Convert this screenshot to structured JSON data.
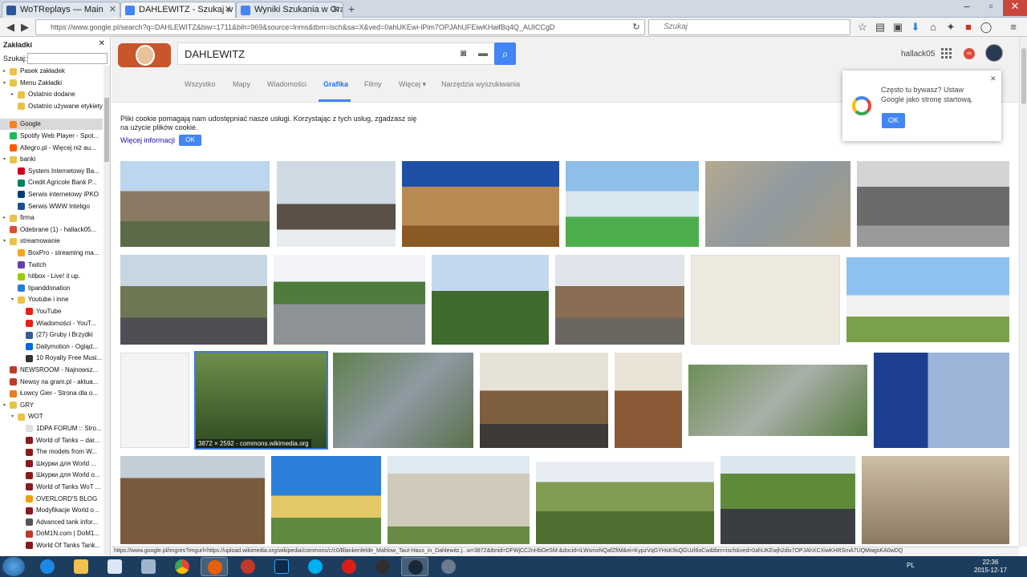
{
  "browser": {
    "tabs": [
      {
        "label": "WoTReplays — Main",
        "color": "#2b5797"
      },
      {
        "label": "DAHLEWITZ - Szukaj w Go...",
        "color": "#4285f4"
      },
      {
        "label": "Wyniki Szukania w Grafice ...",
        "color": "#4285f4"
      }
    ],
    "url": "https://www.google.pl/search?q=DAHLEWITZ&biw=1711&bih=969&source=lnms&tbm=isch&sa=X&ved=0ahUKEwi-lPim7OPJAhUFEiwKHaifBq4Q_AUICCgD",
    "search_placeholder": "Szukaj"
  },
  "sidebar": {
    "title": "Zakładki",
    "search_label": "Szukaj:",
    "items": [
      {
        "label": "Pasek zakładek",
        "indent": 0,
        "type": "folder",
        "tw": "▸"
      },
      {
        "label": "Menu Zakładki",
        "indent": 0,
        "type": "folder",
        "tw": "▾"
      },
      {
        "label": "Ostatnio dodane",
        "indent": 1,
        "type": "folder",
        "tw": "▸"
      },
      {
        "label": "Ostatnio używane etykiety",
        "indent": 1,
        "type": "folder",
        "tw": ""
      },
      {
        "label": "",
        "indent": 0,
        "type": "sep",
        "tw": ""
      },
      {
        "label": "Google",
        "indent": 0,
        "type": "site",
        "color": "#f58220",
        "tw": ""
      },
      {
        "label": "Spotify Web Player - Spot...",
        "indent": 0,
        "type": "site",
        "color": "#1db954",
        "tw": ""
      },
      {
        "label": "Allegro.pl - Więcej niż au...",
        "indent": 0,
        "type": "site",
        "color": "#ff5a00",
        "tw": ""
      },
      {
        "label": "banki",
        "indent": 0,
        "type": "folder",
        "tw": "▾"
      },
      {
        "label": "System Internetowy Ba...",
        "indent": 1,
        "type": "site",
        "color": "#d0021b",
        "tw": ""
      },
      {
        "label": "Credit Agricole Bank P...",
        "indent": 1,
        "type": "site",
        "color": "#00805f",
        "tw": ""
      },
      {
        "label": "Serwis internetowy iPKO",
        "indent": 1,
        "type": "site",
        "color": "#003c7d",
        "tw": ""
      },
      {
        "label": "Serwis WWW Inteligo",
        "indent": 1,
        "type": "site",
        "color": "#1a4f8b",
        "tw": ""
      },
      {
        "label": "firma",
        "indent": 0,
        "type": "folder",
        "tw": "▸"
      },
      {
        "label": "Odebrane (1) - hallack05...",
        "indent": 0,
        "type": "site",
        "color": "#dd4b39",
        "tw": ""
      },
      {
        "label": "streamowanie",
        "indent": 0,
        "type": "folder",
        "tw": "▾"
      },
      {
        "label": "BoxPro - streaming ma...",
        "indent": 1,
        "type": "site",
        "color": "#f5a623",
        "tw": ""
      },
      {
        "label": "Twitch",
        "indent": 1,
        "type": "site",
        "color": "#6441a5",
        "tw": ""
      },
      {
        "label": "hitbox - Live! it up.",
        "indent": 1,
        "type": "site",
        "color": "#99cc00",
        "tw": ""
      },
      {
        "label": "tipanddonation",
        "indent": 1,
        "type": "site",
        "color": "#2b7bd8",
        "tw": ""
      },
      {
        "label": "Youtube i inne",
        "indent": 1,
        "type": "folder",
        "tw": "▾"
      },
      {
        "label": "YouTube",
        "indent": 2,
        "type": "site",
        "color": "#e62117",
        "tw": ""
      },
      {
        "label": "Wiadomości - YouT...",
        "indent": 2,
        "type": "site",
        "color": "#e62117",
        "tw": ""
      },
      {
        "label": "(27) Gruby i Brzydki",
        "indent": 2,
        "type": "site",
        "color": "#3b5998",
        "tw": ""
      },
      {
        "label": "Dailymotion - Ogląd...",
        "indent": 2,
        "type": "site",
        "color": "#0066dc",
        "tw": ""
      },
      {
        "label": "10 Royalty Free Musi...",
        "indent": 2,
        "type": "site",
        "color": "#333333",
        "tw": ""
      },
      {
        "label": "NEWSROOM - Najnowsz...",
        "indent": 0,
        "type": "site",
        "color": "#c0392b",
        "tw": ""
      },
      {
        "label": "Newsy na gram.pl - aktua...",
        "indent": 0,
        "type": "site",
        "color": "#c0392b",
        "tw": ""
      },
      {
        "label": "Łowcy Gier - Strona dla o...",
        "indent": 0,
        "type": "site",
        "color": "#e67e22",
        "tw": ""
      },
      {
        "label": "GRY",
        "indent": 0,
        "type": "folder",
        "tw": "▾"
      },
      {
        "label": "WOT",
        "indent": 1,
        "type": "folder",
        "tw": "▾"
      },
      {
        "label": "1DPA FORUM :: Stro...",
        "indent": 2,
        "type": "site",
        "color": "#dddddd",
        "tw": ""
      },
      {
        "label": "World of Tanks – dar...",
        "indent": 2,
        "type": "site",
        "color": "#8b1a1a",
        "tw": ""
      },
      {
        "label": "The models from W...",
        "indent": 2,
        "type": "site",
        "color": "#8b1a1a",
        "tw": ""
      },
      {
        "label": "Шкурки для World ...",
        "indent": 2,
        "type": "site",
        "color": "#8b1a1a",
        "tw": ""
      },
      {
        "label": "Шкурки для World o...",
        "indent": 2,
        "type": "site",
        "color": "#8b1a1a",
        "tw": ""
      },
      {
        "label": "World of Tanks WoT ...",
        "indent": 2,
        "type": "site",
        "color": "#8b1a1a",
        "tw": ""
      },
      {
        "label": "OVERLORD'S BLOG",
        "indent": 2,
        "type": "site",
        "color": "#f39c12",
        "tw": ""
      },
      {
        "label": "Modyfikacje World o...",
        "indent": 2,
        "type": "site",
        "color": "#8b1a1a",
        "tw": ""
      },
      {
        "label": "Advanced tank infor...",
        "indent": 2,
        "type": "site",
        "color": "#555555",
        "tw": ""
      },
      {
        "label": "DoM1N.com | DoM1...",
        "indent": 2,
        "type": "site",
        "color": "#c0392b",
        "tw": ""
      },
      {
        "label": "World Of Tanks Tank...",
        "indent": 2,
        "type": "site",
        "color": "#8b1a1a",
        "tw": ""
      }
    ]
  },
  "google": {
    "query": "DAHLEWITZ",
    "user": "hallack05",
    "tabs": [
      "Wszystko",
      "Mapy",
      "Wiadomości",
      "Grafika",
      "Filmy",
      "Więcej ▾",
      "Narzędzia wyszukiwania"
    ],
    "active_tab": "Grafika",
    "cookie_text": "Pliki cookie pomagają nam udostępniać nasze usługi. Korzystając z tych usług, zgadzasz się na użycie plików cookie.",
    "cookie_more": "Więcej informacji",
    "cookie_ok": "OK",
    "promo_text": "Często tu bywasz? Ustaw Google jako stronę startową.",
    "promo_ok": "OK",
    "image_caption": "3872 × 2592 - commons.wikimedia.org"
  },
  "status_url": "https://www.google.pl/imgres?imgurl=https://upload.wikimedia.org/wikipedia/commons/c/c0/Blankenfelde_Mahlow_Taut-Haus_in_Dahlewitz.j...w=3872&tbnid=DFWjCC2nHbOeSM:&docid=iLWsmxNQafZfiM&ei=KypzVqGYHsK9sQGUzl6oCw&tbm=isch&ved=0ahUKEwjh2dix7OPJAhXCXiwKHRSmA7UQMwgsKA0wDQ",
  "taskbar": {
    "lang": "PL",
    "time": "22:36",
    "date": "2015-12-17"
  }
}
